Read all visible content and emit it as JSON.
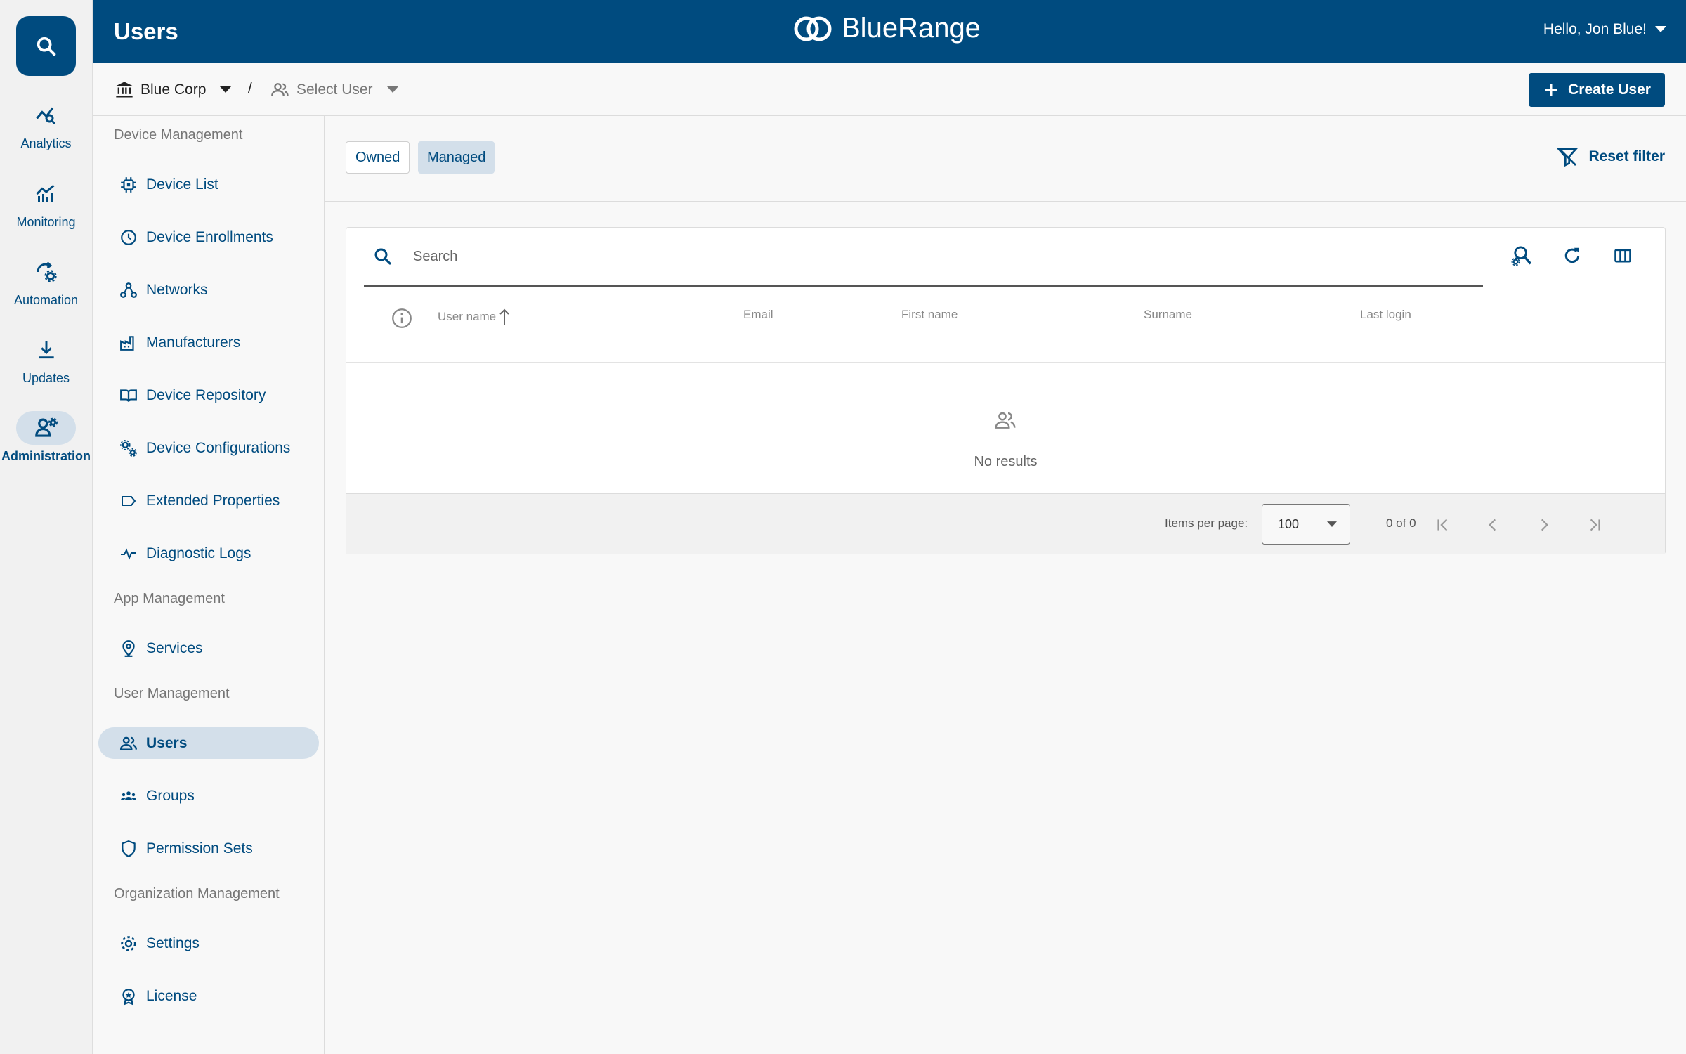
{
  "rail": {
    "items": [
      {
        "label": "Analytics",
        "icon": "analytics-icon"
      },
      {
        "label": "Monitoring",
        "icon": "monitoring-icon"
      },
      {
        "label": "Automation",
        "icon": "automation-icon"
      },
      {
        "label": "Updates",
        "icon": "download-icon"
      },
      {
        "label": "Administration",
        "icon": "admin-icon"
      }
    ]
  },
  "header": {
    "title": "Users",
    "brand": "BlueRange",
    "greeting": "Hello, Jon Blue!"
  },
  "breadcrumb": {
    "organization": "Blue Corp",
    "separator": "/",
    "user_placeholder": "Select User"
  },
  "actions": {
    "create_user": "Create User"
  },
  "sidebar": {
    "sections": [
      {
        "title": "Device Management",
        "items": [
          "Device List",
          "Device Enrollments",
          "Networks",
          "Manufacturers",
          "Device Repository",
          "Device Configurations",
          "Extended Properties",
          "Diagnostic Logs"
        ]
      },
      {
        "title": "App Management",
        "items": [
          "Services"
        ]
      },
      {
        "title": "User Management",
        "items": [
          "Users",
          "Groups",
          "Permission Sets"
        ]
      },
      {
        "title": "Organization Management",
        "items": [
          "Settings",
          "License"
        ]
      }
    ],
    "active_item": "Users"
  },
  "filters": {
    "owned": "Owned",
    "managed": "Managed",
    "active": "Managed",
    "reset": "Reset filter"
  },
  "table": {
    "search_placeholder": "Search",
    "columns": [
      "User name",
      "Email",
      "First name",
      "Surname",
      "Last login"
    ],
    "sort_column": "User name",
    "empty_text": "No results",
    "paginator": {
      "items_per_page_label": "Items per page:",
      "items_per_page": "100",
      "range": "0 of 0"
    }
  },
  "colors": {
    "primary": "#004b7f",
    "active_bg": "#d3dfea",
    "background": "#f8f8f8"
  }
}
